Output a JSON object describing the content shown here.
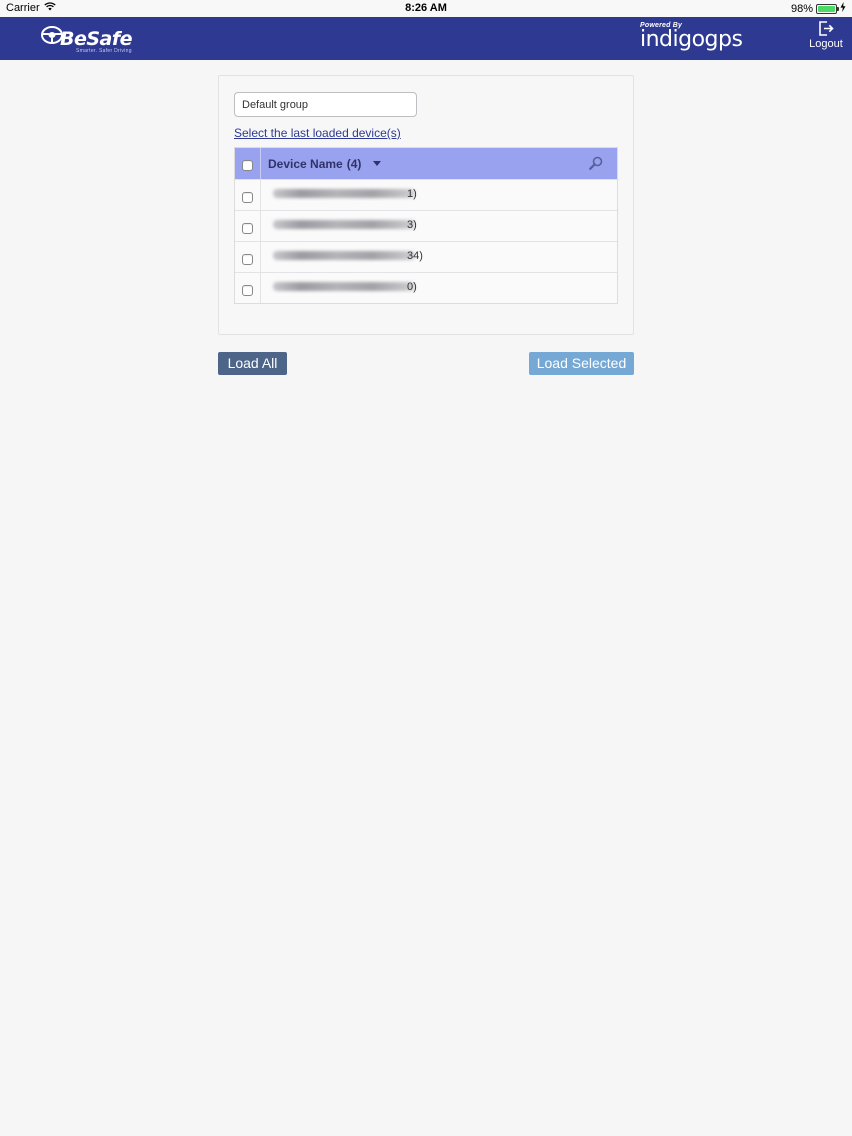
{
  "status_bar": {
    "carrier": "Carrier",
    "time": "8:26 AM",
    "battery_percent": "98%",
    "battery_level": 0.98,
    "icons": [
      "wifi-icon",
      "battery-icon",
      "charging-bolt-icon"
    ]
  },
  "header": {
    "background": "#2e3a91",
    "brand": {
      "name": "BeSafe",
      "tagline": "Smarter. Safer Driving"
    },
    "powered_by": {
      "label": "Powered By",
      "name": "indigogps"
    },
    "logout_label": "Logout",
    "logout_icon": "logout-icon"
  },
  "panel": {
    "group_select_value": "Default group",
    "last_loaded_link": "Select the last loaded device(s)",
    "grid": {
      "header_background": "#98a2ee",
      "column_title": "Device Name",
      "count": "(4)",
      "rows": [
        {
          "suffix": "1)",
          "checked": false
        },
        {
          "suffix": "3)",
          "checked": false
        },
        {
          "suffix": "34)",
          "checked": false
        },
        {
          "suffix": "0)",
          "checked": false
        }
      ]
    }
  },
  "actions": {
    "load_all": "Load All",
    "load_selected": "Load Selected",
    "load_all_color": "#4c6588",
    "load_selected_color": "#75a8d4"
  }
}
